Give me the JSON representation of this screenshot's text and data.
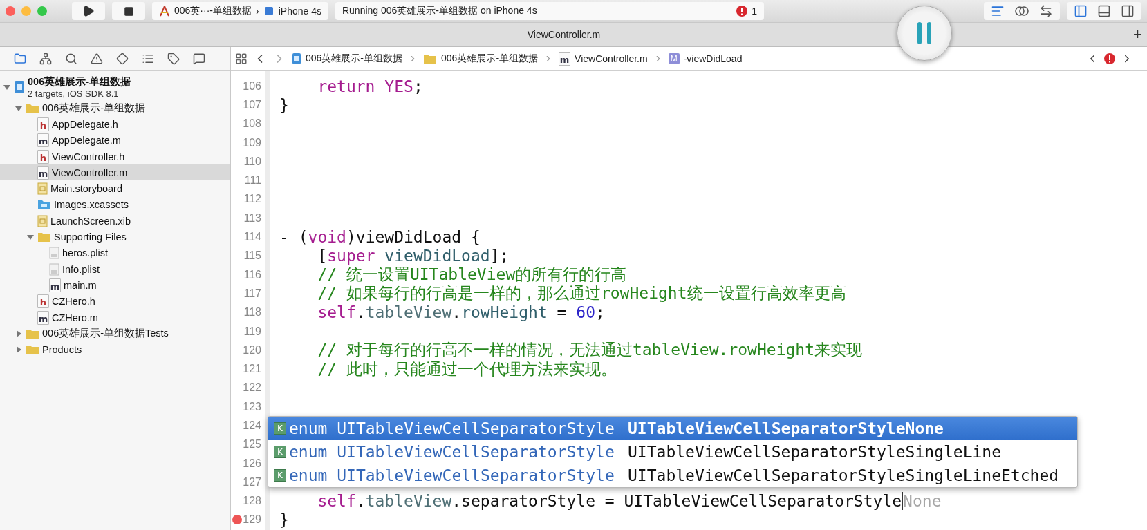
{
  "toolbar": {
    "scheme": {
      "project": "006英···-单组数据",
      "separator": "›",
      "device": "iPhone 4s"
    },
    "status": {
      "text": "Running 006英雄展示-单组数据 on iPhone 4s",
      "error_count": "1"
    },
    "editor_modes": [
      {
        "selected": true
      },
      {
        "selected": false
      },
      {
        "selected": false
      }
    ],
    "view_toggles": [
      {
        "selected": true
      },
      {
        "selected": false
      },
      {
        "selected": false
      }
    ]
  },
  "tab_bar": {
    "title": "ViewController.m",
    "add": "+"
  },
  "navigator_tabs": [
    {
      "selected": true
    },
    {
      "selected": false
    },
    {
      "selected": false
    },
    {
      "selected": false
    },
    {
      "selected": false
    },
    {
      "selected": false
    },
    {
      "selected": false
    },
    {
      "selected": false
    }
  ],
  "jump_bar": [
    {
      "kind": "project",
      "label": "006英雄展示-单组数据"
    },
    {
      "kind": "folder",
      "label": "006英雄展示-单组数据"
    },
    {
      "kind": "source",
      "glyph": "m",
      "label": "ViewController.m"
    },
    {
      "kind": "method",
      "glyph": "M",
      "label": "-viewDidLoad"
    }
  ],
  "sidebar": {
    "items": [
      {
        "kind": "project",
        "label": "006英雄展示-单组数据",
        "subtitle": "2 targets, iOS SDK 8.1",
        "expanded": true,
        "selected": false,
        "children": [
          {
            "kind": "folder",
            "label": "006英雄展示-单组数据",
            "expanded": true,
            "selected": false,
            "children": [
              {
                "kind": "header",
                "glyph": "h",
                "label": "AppDelegate.h",
                "selected": false
              },
              {
                "kind": "source",
                "glyph": "m",
                "label": "AppDelegate.m",
                "selected": false
              },
              {
                "kind": "header",
                "glyph": "h",
                "label": "ViewController.h",
                "selected": false
              },
              {
                "kind": "source",
                "glyph": "m",
                "label": "ViewController.m",
                "selected": true
              },
              {
                "kind": "storyboard",
                "label": "Main.storyboard",
                "selected": false
              },
              {
                "kind": "assets",
                "label": "Images.xcassets",
                "selected": false
              },
              {
                "kind": "xib",
                "label": "LaunchScreen.xib",
                "selected": false
              },
              {
                "kind": "folder",
                "label": "Supporting Files",
                "expanded": true,
                "selected": false,
                "children": [
                  {
                    "kind": "plist",
                    "label": "heros.plist",
                    "selected": false
                  },
                  {
                    "kind": "plist",
                    "label": "Info.plist",
                    "selected": false
                  },
                  {
                    "kind": "source",
                    "glyph": "m",
                    "label": "main.m",
                    "selected": false
                  }
                ]
              },
              {
                "kind": "header",
                "glyph": "h",
                "label": "CZHero.h",
                "selected": false
              },
              {
                "kind": "source",
                "glyph": "m",
                "label": "CZHero.m",
                "selected": false
              }
            ]
          },
          {
            "kind": "folder",
            "label": "006英雄展示-单组数据Tests",
            "expanded": false,
            "selected": false
          },
          {
            "kind": "folder",
            "label": "Products",
            "expanded": false,
            "selected": false
          }
        ]
      }
    ]
  },
  "editor": {
    "lines": [
      {
        "number": "106",
        "error": false,
        "tokens": [
          {
            "text": "    return",
            "kind": "keyword"
          },
          {
            "text": " YES",
            "kind": "keyword"
          },
          {
            "text": ";",
            "kind": "plain"
          }
        ]
      },
      {
        "number": "107",
        "error": false,
        "tokens": [
          {
            "text": "}",
            "kind": "plain"
          }
        ]
      },
      {
        "number": "108",
        "error": false
      },
      {
        "number": "109",
        "error": false
      },
      {
        "number": "110",
        "error": false
      },
      {
        "number": "111",
        "error": false
      },
      {
        "number": "112",
        "error": false
      },
      {
        "number": "113",
        "error": false
      },
      {
        "number": "114",
        "error": false,
        "tokens": [
          {
            "text": "- (",
            "kind": "plain"
          },
          {
            "text": "void",
            "kind": "keyword"
          },
          {
            "text": ")viewDidLoad {",
            "kind": "plain"
          }
        ]
      },
      {
        "number": "115",
        "error": false,
        "tokens": [
          {
            "text": "    [",
            "kind": "plain"
          },
          {
            "text": "super",
            "kind": "keyword"
          },
          {
            "text": " viewDidLoad",
            "kind": "method"
          },
          {
            "text": "];",
            "kind": "plain"
          }
        ]
      },
      {
        "number": "116",
        "error": false,
        "tokens": [
          {
            "text": "    // 统一设置UITableView的所有行的行高",
            "kind": "comment"
          }
        ]
      },
      {
        "number": "117",
        "error": false,
        "tokens": [
          {
            "text": "    // 如果每行的行高是一样的，那么通过rowHeight统一设置行高效率更高",
            "kind": "comment"
          }
        ]
      },
      {
        "number": "118",
        "error": false,
        "tokens": [
          {
            "text": "    self",
            "kind": "keyword"
          },
          {
            "text": ".",
            "kind": "plain"
          },
          {
            "text": "tableView",
            "kind": "property"
          },
          {
            "text": ".",
            "kind": "plain"
          },
          {
            "text": "rowHeight",
            "kind": "method"
          },
          {
            "text": " =",
            "kind": "plain"
          },
          {
            "text": " 60",
            "kind": "number"
          },
          {
            "text": ";",
            "kind": "plain"
          }
        ]
      },
      {
        "number": "119",
        "error": false
      },
      {
        "number": "120",
        "error": false,
        "tokens": [
          {
            "text": "    // 对于每行的行高不一样的情况，无法通过tableView.rowHeight来实现",
            "kind": "comment"
          }
        ]
      },
      {
        "number": "121",
        "error": false,
        "tokens": [
          {
            "text": "    // 此时，只能通过一个代理方法来实现。",
            "kind": "comment"
          }
        ]
      },
      {
        "number": "122",
        "error": false
      },
      {
        "number": "123",
        "error": false
      },
      {
        "number": "124",
        "error": false
      },
      {
        "number": "125",
        "error": false
      },
      {
        "number": "126",
        "error": false
      },
      {
        "number": "127",
        "error": false
      },
      {
        "number": "128",
        "error": false,
        "tokens": [
          {
            "text": "    self",
            "kind": "keyword"
          },
          {
            "text": ".",
            "kind": "plain"
          },
          {
            "text": "tableView",
            "kind": "property"
          },
          {
            "text": ".separatorStyle = UITableViewCellSeparatorStyle",
            "kind": "plain"
          },
          {
            "text": "None",
            "kind": "ghost"
          }
        ]
      },
      {
        "number": "129",
        "error": true,
        "tokens": [
          {
            "text": "}",
            "kind": "plain"
          }
        ]
      }
    ]
  },
  "completions": [
    {
      "badge": "K",
      "type": "enum UITableViewCellSeparatorStyle",
      "name": "UITableViewCellSeparatorStyleNone",
      "selected": true
    },
    {
      "badge": "K",
      "type": "enum UITableViewCellSeparatorStyle",
      "name": "UITableViewCellSeparatorStyleSingleLine",
      "selected": false
    },
    {
      "badge": "K",
      "type": "enum UITableViewCellSeparatorStyle",
      "name": "UITableViewCellSeparatorStyleSingleLineEtched",
      "selected": false
    }
  ]
}
